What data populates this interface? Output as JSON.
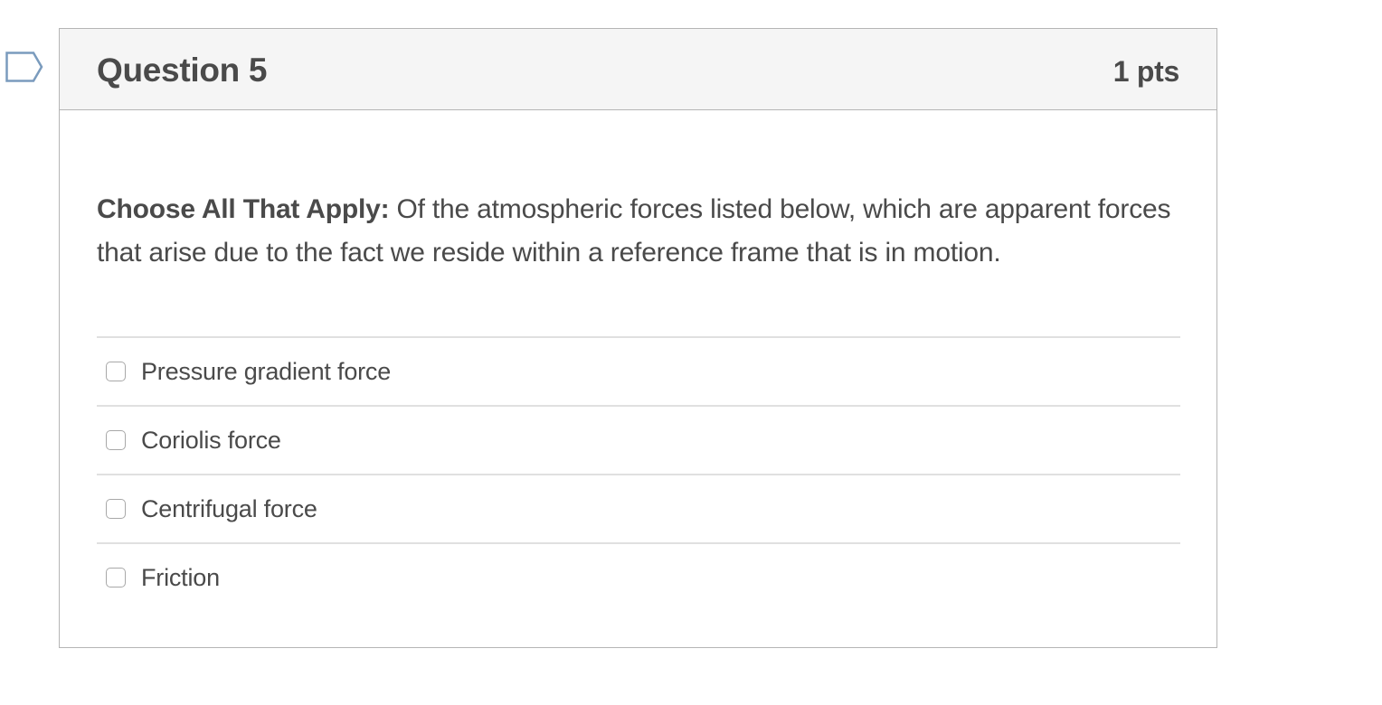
{
  "question": {
    "title": "Question 5",
    "points": "1 pts",
    "prompt_lead": "Choose All That Apply:",
    "prompt_text": " Of the atmospheric forces listed below, which are apparent forces that arise due to the fact we reside within a reference frame that is in motion."
  },
  "answers": [
    {
      "label": "Pressure gradient force",
      "checked": false
    },
    {
      "label": "Coriolis force",
      "checked": false
    },
    {
      "label": "Centrifugal force",
      "checked": false
    },
    {
      "label": "Friction",
      "checked": false
    }
  ],
  "colors": {
    "header_bg": "#f5f5f5",
    "border": "#b5b5b5",
    "text": "#4a4a4a",
    "flag_outline": "#7a9bbd"
  },
  "icons": {
    "flag": "flag-bookmark-icon"
  }
}
